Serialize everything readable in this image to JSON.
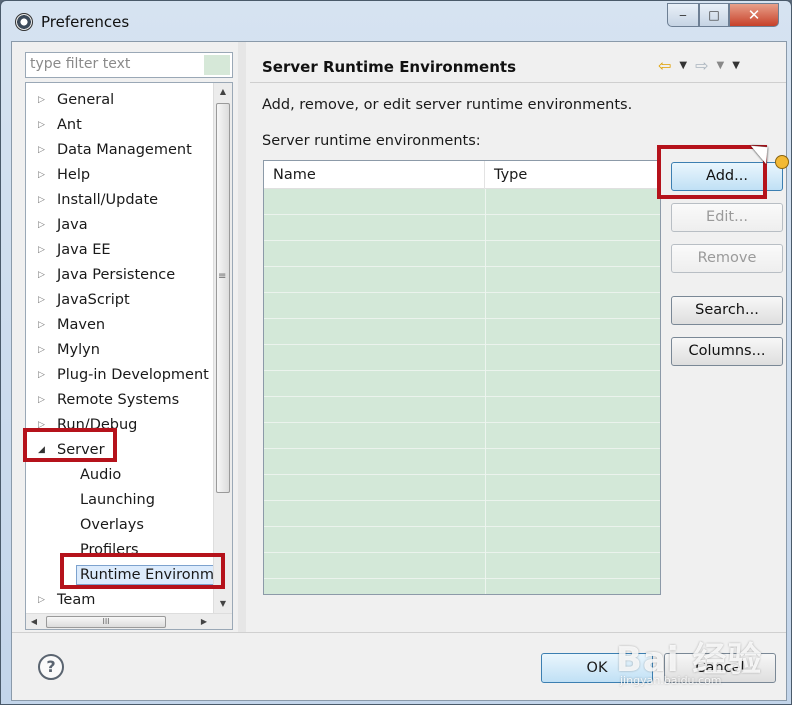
{
  "window": {
    "title": "Preferences",
    "icon": "eclipse-gear-icon",
    "controls": {
      "minimize": "‒",
      "maximize": "□",
      "close": "✕"
    }
  },
  "filter": {
    "placeholder": "type filter text",
    "value": ""
  },
  "tree": {
    "items": [
      {
        "label": "General",
        "expanded": false
      },
      {
        "label": "Ant",
        "expanded": false
      },
      {
        "label": "Data Management",
        "expanded": false
      },
      {
        "label": "Help",
        "expanded": false
      },
      {
        "label": "Install/Update",
        "expanded": false
      },
      {
        "label": "Java",
        "expanded": false
      },
      {
        "label": "Java EE",
        "expanded": false
      },
      {
        "label": "Java Persistence",
        "expanded": false
      },
      {
        "label": "JavaScript",
        "expanded": false
      },
      {
        "label": "Maven",
        "expanded": false
      },
      {
        "label": "Mylyn",
        "expanded": false
      },
      {
        "label": "Plug-in Development",
        "expanded": false
      },
      {
        "label": "Remote Systems",
        "expanded": false
      },
      {
        "label": "Run/Debug",
        "expanded": false
      },
      {
        "label": "Server",
        "expanded": true,
        "children": [
          "Audio",
          "Launching",
          "Overlays",
          "Profilers",
          "Runtime Environm"
        ]
      },
      {
        "label": "Team",
        "expanded": false
      }
    ],
    "selected": "Runtime Environm"
  },
  "panel": {
    "title": "Server Runtime Environments",
    "description": "Add, remove, or edit server runtime environments.",
    "list_label": "Server runtime environments:",
    "columns": [
      "Name",
      "Type"
    ],
    "rows": []
  },
  "buttons": {
    "add": "Add...",
    "edit": "Edit...",
    "remove": "Remove",
    "search": "Search...",
    "columns": "Columns..."
  },
  "footer": {
    "ok": "OK",
    "cancel": "Cancel",
    "help": "?"
  },
  "watermark": {
    "text": "Bai 经验",
    "sub": "jingyan.baidu.com"
  },
  "colors": {
    "highlight": "#b5121b",
    "table_bg": "#d3e8d8",
    "primary_button": "#c0e0f5"
  }
}
